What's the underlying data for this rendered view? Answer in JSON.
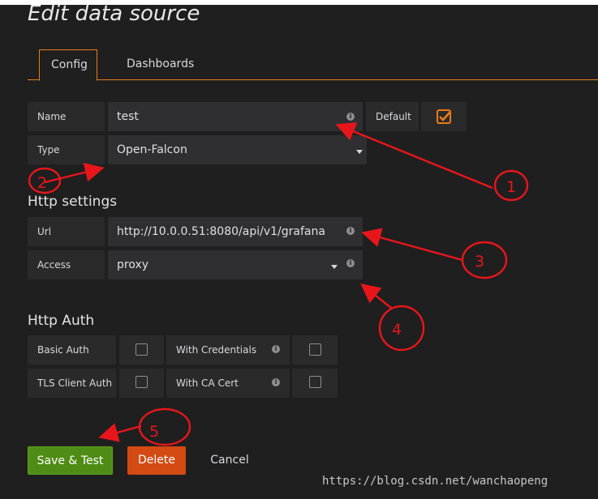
{
  "page": {
    "title": "Edit data source"
  },
  "tabs": [
    {
      "label": "Config"
    },
    {
      "label": "Dashboards"
    }
  ],
  "fields": {
    "name": {
      "label": "Name",
      "value": "test",
      "default_label": "Default",
      "default_checked": true
    },
    "type": {
      "label": "Type",
      "value": "Open-Falcon"
    }
  },
  "http_settings": {
    "title": "Http settings",
    "url": {
      "label": "Url",
      "value": "http://10.0.0.51:8080/api/v1/grafana"
    },
    "access": {
      "label": "Access",
      "value": "proxy"
    }
  },
  "http_auth": {
    "title": "Http Auth",
    "basic_auth": "Basic Auth",
    "with_credentials": "With Credentials",
    "tls_client_auth": "TLS Client Auth",
    "with_ca_cert": "With CA Cert"
  },
  "buttons": {
    "save": "Save & Test",
    "delete": "Delete",
    "cancel": "Cancel"
  },
  "annotations": [
    "1",
    "2",
    "3",
    "4",
    "5"
  ],
  "watermark": "https://blog.csdn.net/wanchaopeng",
  "colors": {
    "accent": "#eb7b18",
    "annotation": "#e8161b",
    "save_bg": "#4f8c15",
    "delete_bg": "#d44a13"
  }
}
